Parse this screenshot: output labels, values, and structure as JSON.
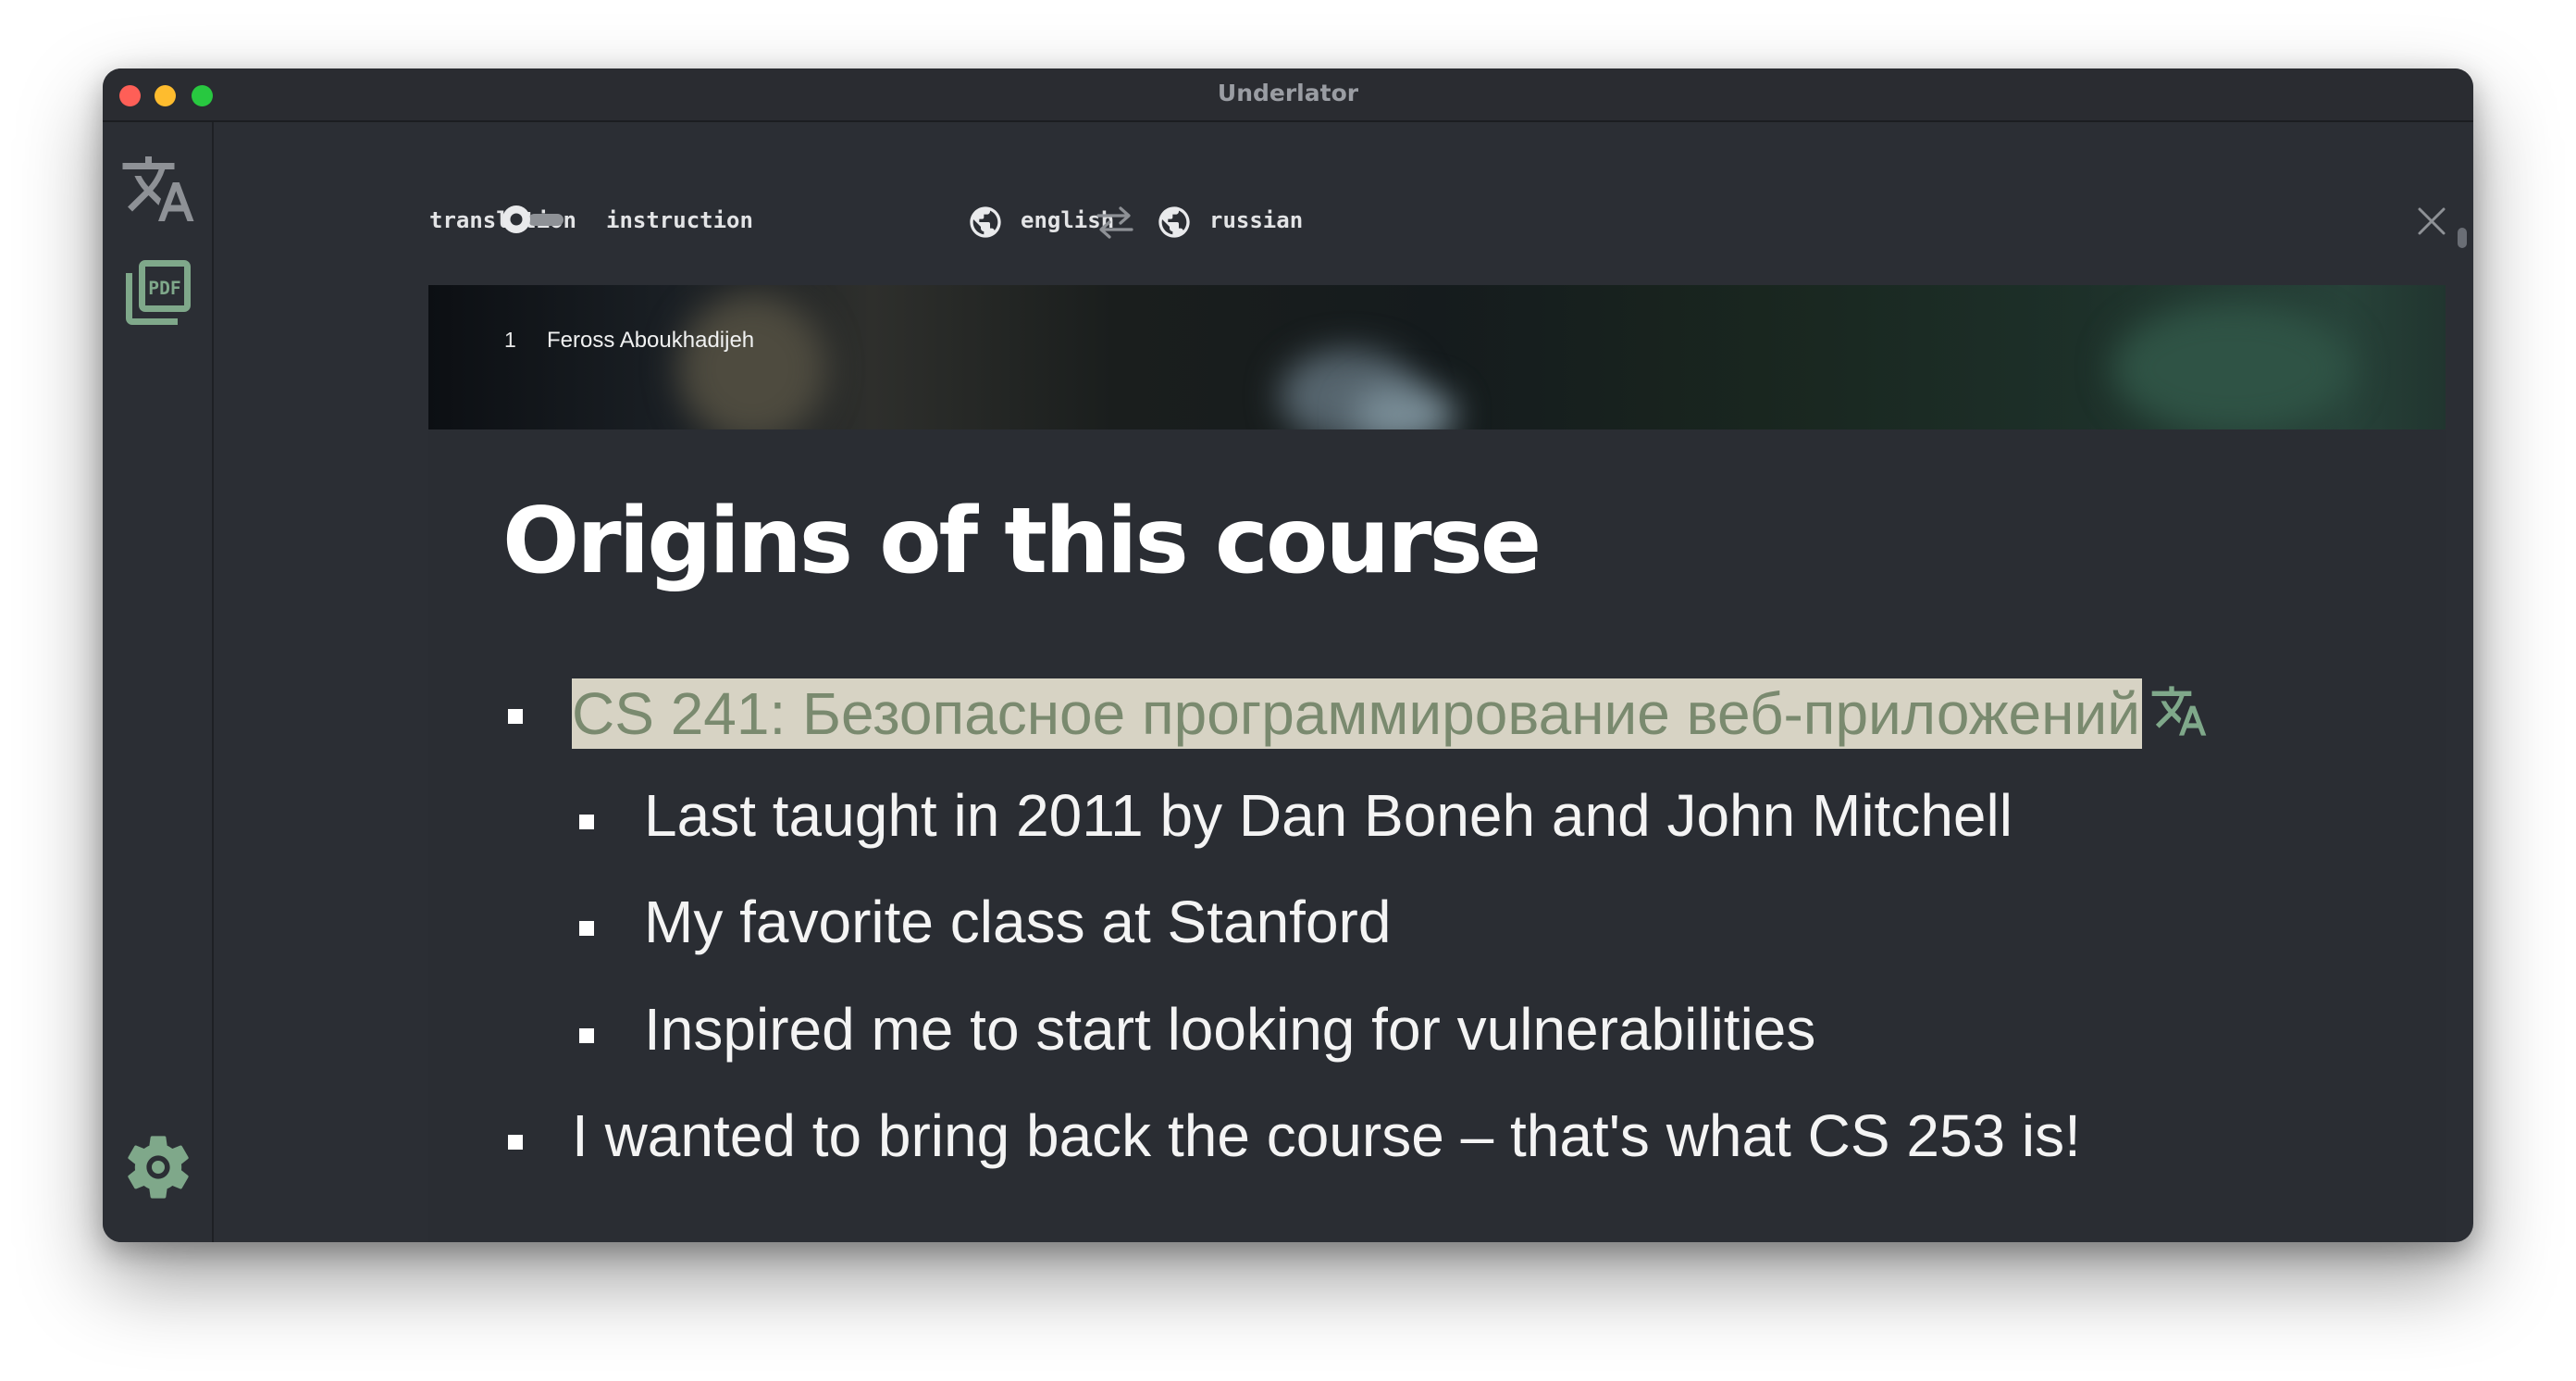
{
  "window": {
    "title": "Underlator"
  },
  "sidebar": {
    "items": [
      {
        "name": "translate-icon"
      },
      {
        "name": "pdf-icon"
      },
      {
        "name": "gear-icon"
      }
    ]
  },
  "toolbar": {
    "mode_left_label": "translation",
    "mode_right_label": "instruction",
    "source_language": "english",
    "target_language": "russian",
    "swap_icon": "swap-arrows-icon",
    "close_icon": "close-icon"
  },
  "slide": {
    "header_number": "1",
    "header_name": "Feross Aboukhadijeh",
    "title": "Origins of this course",
    "bullets": [
      {
        "text": "CS 241: Безопасное программирование веб-приложений",
        "translated": true
      },
      {
        "text": "Last taught in 2011 by Dan Boneh and John Mitchell"
      },
      {
        "text": "My favorite class at Stanford"
      },
      {
        "text": "Inspired me to start looking for vulnerabilities"
      },
      {
        "text": "I wanted to bring back the course – that's what CS 253 is!"
      }
    ]
  },
  "colors": {
    "accent_green": "#7fa88a",
    "highlight_bg": "#d7d3c4",
    "highlight_text": "#7a8a6f",
    "window_bg": "#2b2e34"
  }
}
